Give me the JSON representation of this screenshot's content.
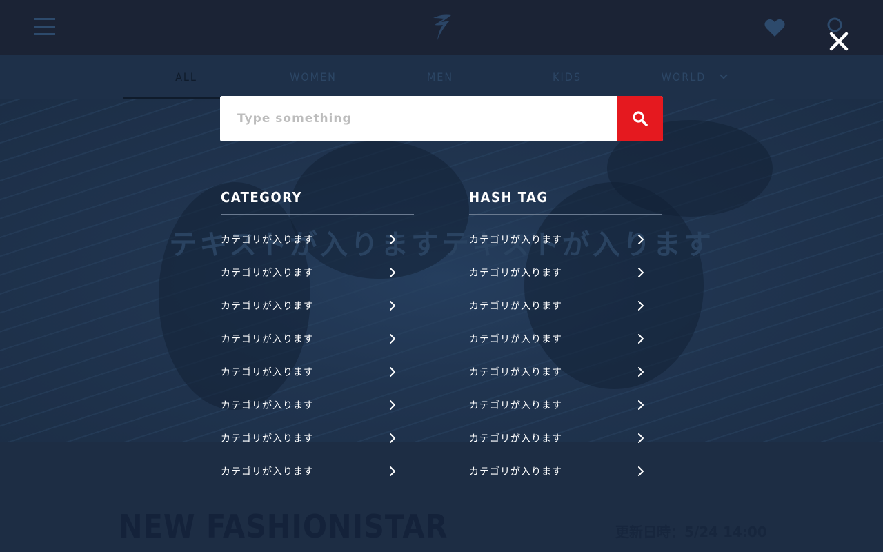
{
  "header": {
    "logo_icon": "brand-logo-icon",
    "menu_icon": "hamburger-menu-icon",
    "favorite_icon": "heart-icon",
    "search_icon": "search-icon"
  },
  "nav": {
    "items": [
      {
        "label": "ALL",
        "active": true
      },
      {
        "label": "WOMEN"
      },
      {
        "label": "MEN"
      },
      {
        "label": "KIDS"
      },
      {
        "label": "WORLD"
      }
    ]
  },
  "hero": {
    "text": "テキストが入りますテキストが入ります"
  },
  "section": {
    "title": "NEW  FASHIONISTAR",
    "updated": "更新日時：5/24 14:00"
  },
  "search": {
    "placeholder": "Type something",
    "value": "",
    "button_color": "#e5191f",
    "close_icon": "close-icon"
  },
  "category": {
    "title": "CATEGORY",
    "items": [
      "カテゴリが入ります",
      "カテゴリが入ります",
      "カテゴリが入ります",
      "カテゴリが入ります",
      "カテゴリが入ります",
      "カテゴリが入ります",
      "カテゴリが入ります",
      "カテゴリが入ります"
    ]
  },
  "hashtag": {
    "title": "HASH TAG",
    "items": [
      "カテゴリが入ります",
      "カテゴリが入ります",
      "カテゴリが入ります",
      "カテゴリが入ります",
      "カテゴリが入ります",
      "カテゴリが入ります",
      "カテゴリが入ります",
      "カテゴリが入ります"
    ]
  }
}
